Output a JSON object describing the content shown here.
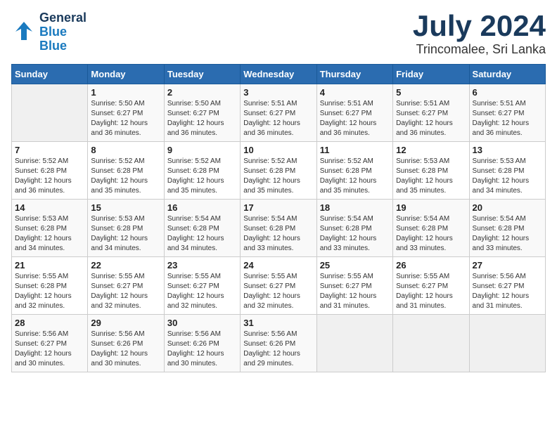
{
  "header": {
    "logo_general": "General",
    "logo_blue": "Blue",
    "month": "July 2024",
    "location": "Trincomalee, Sri Lanka"
  },
  "days_of_week": [
    "Sunday",
    "Monday",
    "Tuesday",
    "Wednesday",
    "Thursday",
    "Friday",
    "Saturday"
  ],
  "weeks": [
    [
      {
        "day": "",
        "info": ""
      },
      {
        "day": "1",
        "info": "Sunrise: 5:50 AM\nSunset: 6:27 PM\nDaylight: 12 hours\nand 36 minutes."
      },
      {
        "day": "2",
        "info": "Sunrise: 5:50 AM\nSunset: 6:27 PM\nDaylight: 12 hours\nand 36 minutes."
      },
      {
        "day": "3",
        "info": "Sunrise: 5:51 AM\nSunset: 6:27 PM\nDaylight: 12 hours\nand 36 minutes."
      },
      {
        "day": "4",
        "info": "Sunrise: 5:51 AM\nSunset: 6:27 PM\nDaylight: 12 hours\nand 36 minutes."
      },
      {
        "day": "5",
        "info": "Sunrise: 5:51 AM\nSunset: 6:27 PM\nDaylight: 12 hours\nand 36 minutes."
      },
      {
        "day": "6",
        "info": "Sunrise: 5:51 AM\nSunset: 6:27 PM\nDaylight: 12 hours\nand 36 minutes."
      }
    ],
    [
      {
        "day": "7",
        "info": "Sunrise: 5:52 AM\nSunset: 6:28 PM\nDaylight: 12 hours\nand 36 minutes."
      },
      {
        "day": "8",
        "info": "Sunrise: 5:52 AM\nSunset: 6:28 PM\nDaylight: 12 hours\nand 35 minutes."
      },
      {
        "day": "9",
        "info": "Sunrise: 5:52 AM\nSunset: 6:28 PM\nDaylight: 12 hours\nand 35 minutes."
      },
      {
        "day": "10",
        "info": "Sunrise: 5:52 AM\nSunset: 6:28 PM\nDaylight: 12 hours\nand 35 minutes."
      },
      {
        "day": "11",
        "info": "Sunrise: 5:52 AM\nSunset: 6:28 PM\nDaylight: 12 hours\nand 35 minutes."
      },
      {
        "day": "12",
        "info": "Sunrise: 5:53 AM\nSunset: 6:28 PM\nDaylight: 12 hours\nand 35 minutes."
      },
      {
        "day": "13",
        "info": "Sunrise: 5:53 AM\nSunset: 6:28 PM\nDaylight: 12 hours\nand 34 minutes."
      }
    ],
    [
      {
        "day": "14",
        "info": "Sunrise: 5:53 AM\nSunset: 6:28 PM\nDaylight: 12 hours\nand 34 minutes."
      },
      {
        "day": "15",
        "info": "Sunrise: 5:53 AM\nSunset: 6:28 PM\nDaylight: 12 hours\nand 34 minutes."
      },
      {
        "day": "16",
        "info": "Sunrise: 5:54 AM\nSunset: 6:28 PM\nDaylight: 12 hours\nand 34 minutes."
      },
      {
        "day": "17",
        "info": "Sunrise: 5:54 AM\nSunset: 6:28 PM\nDaylight: 12 hours\nand 33 minutes."
      },
      {
        "day": "18",
        "info": "Sunrise: 5:54 AM\nSunset: 6:28 PM\nDaylight: 12 hours\nand 33 minutes."
      },
      {
        "day": "19",
        "info": "Sunrise: 5:54 AM\nSunset: 6:28 PM\nDaylight: 12 hours\nand 33 minutes."
      },
      {
        "day": "20",
        "info": "Sunrise: 5:54 AM\nSunset: 6:28 PM\nDaylight: 12 hours\nand 33 minutes."
      }
    ],
    [
      {
        "day": "21",
        "info": "Sunrise: 5:55 AM\nSunset: 6:28 PM\nDaylight: 12 hours\nand 32 minutes."
      },
      {
        "day": "22",
        "info": "Sunrise: 5:55 AM\nSunset: 6:27 PM\nDaylight: 12 hours\nand 32 minutes."
      },
      {
        "day": "23",
        "info": "Sunrise: 5:55 AM\nSunset: 6:27 PM\nDaylight: 12 hours\nand 32 minutes."
      },
      {
        "day": "24",
        "info": "Sunrise: 5:55 AM\nSunset: 6:27 PM\nDaylight: 12 hours\nand 32 minutes."
      },
      {
        "day": "25",
        "info": "Sunrise: 5:55 AM\nSunset: 6:27 PM\nDaylight: 12 hours\nand 31 minutes."
      },
      {
        "day": "26",
        "info": "Sunrise: 5:55 AM\nSunset: 6:27 PM\nDaylight: 12 hours\nand 31 minutes."
      },
      {
        "day": "27",
        "info": "Sunrise: 5:56 AM\nSunset: 6:27 PM\nDaylight: 12 hours\nand 31 minutes."
      }
    ],
    [
      {
        "day": "28",
        "info": "Sunrise: 5:56 AM\nSunset: 6:27 PM\nDaylight: 12 hours\nand 30 minutes."
      },
      {
        "day": "29",
        "info": "Sunrise: 5:56 AM\nSunset: 6:26 PM\nDaylight: 12 hours\nand 30 minutes."
      },
      {
        "day": "30",
        "info": "Sunrise: 5:56 AM\nSunset: 6:26 PM\nDaylight: 12 hours\nand 30 minutes."
      },
      {
        "day": "31",
        "info": "Sunrise: 5:56 AM\nSunset: 6:26 PM\nDaylight: 12 hours\nand 29 minutes."
      },
      {
        "day": "",
        "info": ""
      },
      {
        "day": "",
        "info": ""
      },
      {
        "day": "",
        "info": ""
      }
    ]
  ]
}
